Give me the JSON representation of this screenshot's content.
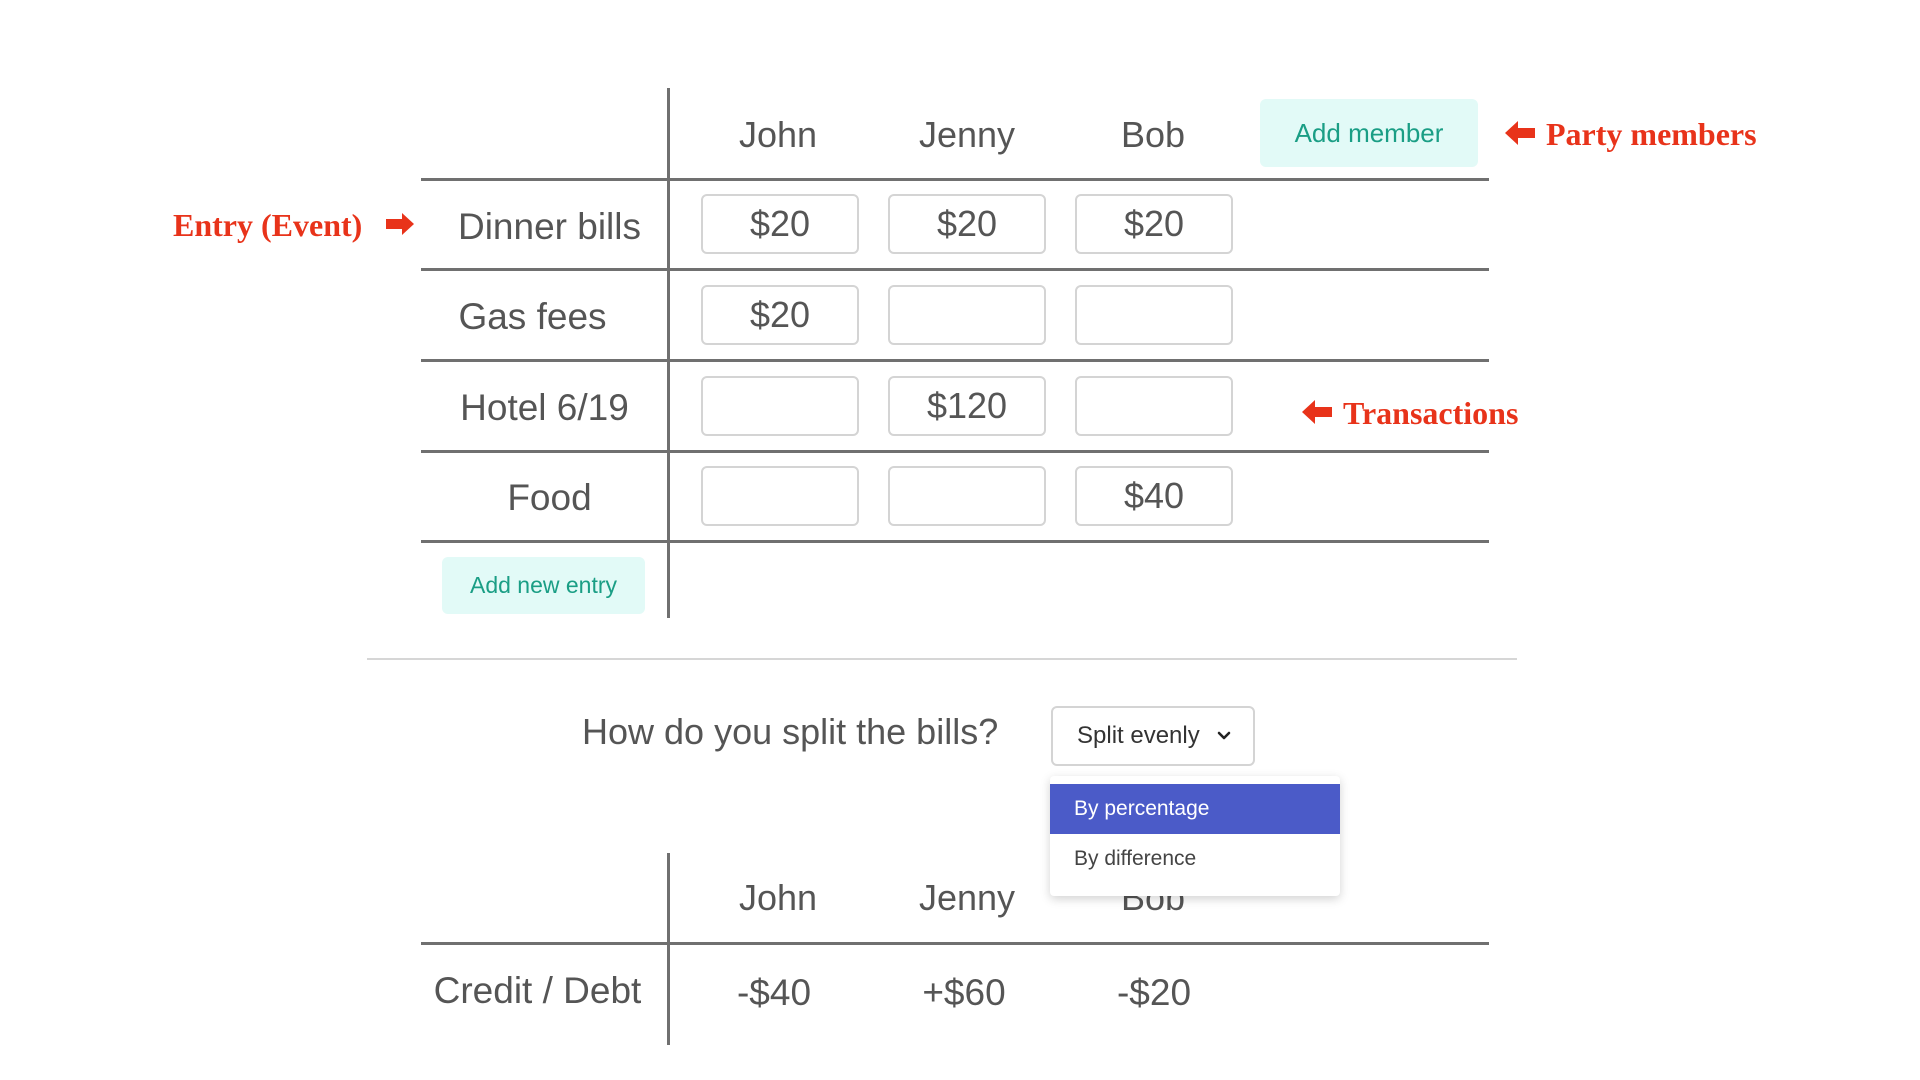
{
  "members": [
    "John",
    "Jenny",
    "Bob"
  ],
  "add_member_label": "Add member",
  "entries": [
    {
      "name": "Dinner bills",
      "values": [
        "$20",
        "$20",
        "$20"
      ]
    },
    {
      "name": "Gas fees",
      "values": [
        "$20",
        "",
        ""
      ]
    },
    {
      "name": "Hotel 6/19",
      "values": [
        "",
        "$120",
        ""
      ]
    },
    {
      "name": "Food",
      "values": [
        "",
        "",
        "$40"
      ]
    }
  ],
  "add_entry_label": "Add new entry",
  "annotations": {
    "party_members": "Party members",
    "entry_event": "Entry (Event)",
    "transactions": "Transactions"
  },
  "split": {
    "question": "How do you split the bills?",
    "selected": "Split evenly",
    "options": [
      "By percentage",
      "By difference"
    ],
    "highlighted_option": "By percentage"
  },
  "results": {
    "members": [
      "John",
      "Jenny",
      "Bob"
    ],
    "label": "Credit / Debt",
    "values": [
      "-$40",
      "+$60",
      "-$20"
    ]
  },
  "colors": {
    "accent_teal_bg": "#e2faf7",
    "accent_teal_text": "#1a9e85",
    "annotation_red": "#e8331a",
    "dropdown_highlight": "#4b5bc8"
  }
}
